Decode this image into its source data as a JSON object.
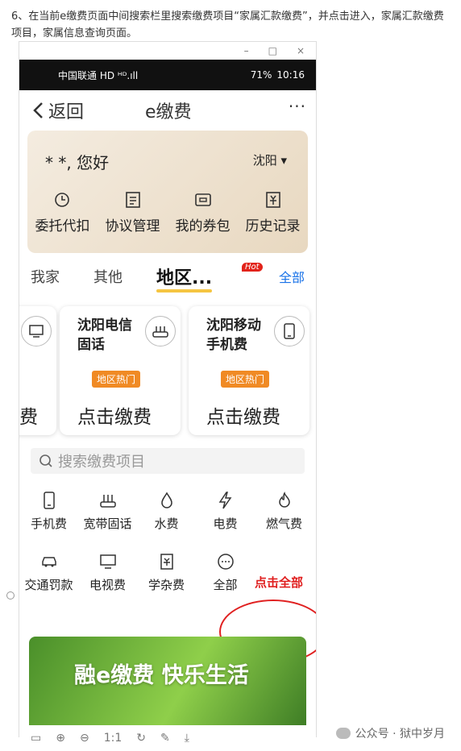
{
  "doc": {
    "text": "6、在当前e缴费页面中间搜索栏里搜索缴费项目“家属汇款缴费”，并点击进入，家属汇款缴费项目，家属信息查询页面。"
  },
  "window": {
    "minimize": "–",
    "maximize": "□",
    "close": "×"
  },
  "status": {
    "carrier": "中国联通 HD ᴴᴰ.ıll",
    "battery": "71%",
    "time": "10:16"
  },
  "nav": {
    "back": "返回",
    "title": "e缴费",
    "more": "···"
  },
  "card": {
    "greeting": "* *, 您好",
    "city": "沈阳 ▾",
    "actions": [
      "委托代扣",
      "协议管理",
      "我的券包",
      "历史记录"
    ]
  },
  "tabs": {
    "items": [
      "我家",
      "其他"
    ],
    "active": "地区...",
    "hot": "Hot",
    "all": "全部"
  },
  "service_cards": [
    {
      "title_line1": "",
      "title_line2": "",
      "tag": "",
      "pay": "费"
    },
    {
      "title_line1": "沈阳电信",
      "title_line2": "固话",
      "tag": "地区热门",
      "pay": "点击缴费"
    },
    {
      "title_line1": "沈阳移动",
      "title_line2": "手机费",
      "tag": "地区热门",
      "pay": "点击缴费"
    }
  ],
  "search": {
    "placeholder": "搜索缴费项目"
  },
  "grid": [
    {
      "label": "手机费",
      "icon": "phone-icon"
    },
    {
      "label": "宽带固话",
      "icon": "router-icon"
    },
    {
      "label": "水费",
      "icon": "water-drop-icon"
    },
    {
      "label": "电费",
      "icon": "lightning-icon"
    },
    {
      "label": "燃气费",
      "icon": "flame-icon"
    },
    {
      "label": "交通罚款",
      "icon": "car-icon"
    },
    {
      "label": "电视费",
      "icon": "tv-icon"
    },
    {
      "label": "学杂费",
      "icon": "book-icon"
    },
    {
      "label": "全部",
      "icon": "more-icon"
    }
  ],
  "annotation": "点击全部",
  "banner": {
    "text": "融e缴费  快乐生活"
  },
  "toolbar": {
    "zoom": "1:1"
  },
  "watermark": "公众号 · 狱中岁月",
  "colors": {
    "accent": "#1a73e8",
    "hot": "#e2231a",
    "tag": "#f08a24",
    "annotation": "#e02020"
  }
}
